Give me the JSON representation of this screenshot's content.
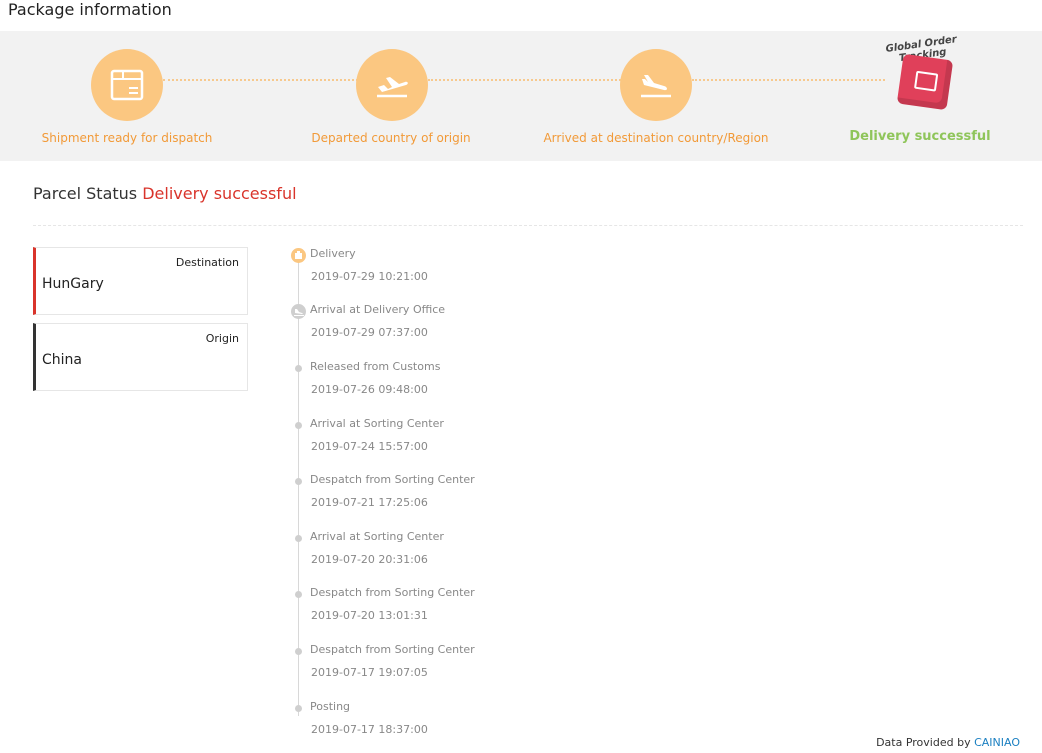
{
  "page": {
    "title": "Package information"
  },
  "steps": [
    {
      "label": "Shipment ready for dispatch",
      "icon": "package-icon"
    },
    {
      "label": "Departed country of origin",
      "icon": "plane-takeoff-icon"
    },
    {
      "label": "Arrived at destination country/Region",
      "icon": "plane-landing-icon"
    },
    {
      "label": "Delivery successful",
      "icon": "global-order-tracking-badge",
      "badge_text": "Global Order Tracking"
    }
  ],
  "status": {
    "label": "Parcel Status",
    "value": "Delivery successful"
  },
  "locations": {
    "destination": {
      "tag": "Destination",
      "name": "HunGary"
    },
    "origin": {
      "tag": "Origin",
      "name": "China"
    }
  },
  "timeline": [
    {
      "title": "Delivery",
      "time": "2019-07-29 10:21:00"
    },
    {
      "title": "Arrival at Delivery Office",
      "time": "2019-07-29 07:37:00"
    },
    {
      "title": "Released from Customs",
      "time": "2019-07-26 09:48:00"
    },
    {
      "title": "Arrival at Sorting Center",
      "time": "2019-07-24 15:57:00"
    },
    {
      "title": "Despatch from Sorting Center",
      "time": "2019-07-21 17:25:06"
    },
    {
      "title": "Arrival at Sorting Center",
      "time": "2019-07-20 20:31:06"
    },
    {
      "title": "Despatch from Sorting Center",
      "time": "2019-07-20 13:01:31"
    },
    {
      "title": "Despatch from Sorting Center",
      "time": "2019-07-17 19:07:05"
    },
    {
      "title": "Posting",
      "time": "2019-07-17 18:37:00"
    }
  ],
  "footer": {
    "text": "Data Provided by",
    "link": "CAINIAO"
  },
  "colors": {
    "accent": "#fbc781",
    "step_text": "#f29a38",
    "success": "#8fc55a",
    "status_red": "#d9342b",
    "link": "#1a7fc1"
  }
}
